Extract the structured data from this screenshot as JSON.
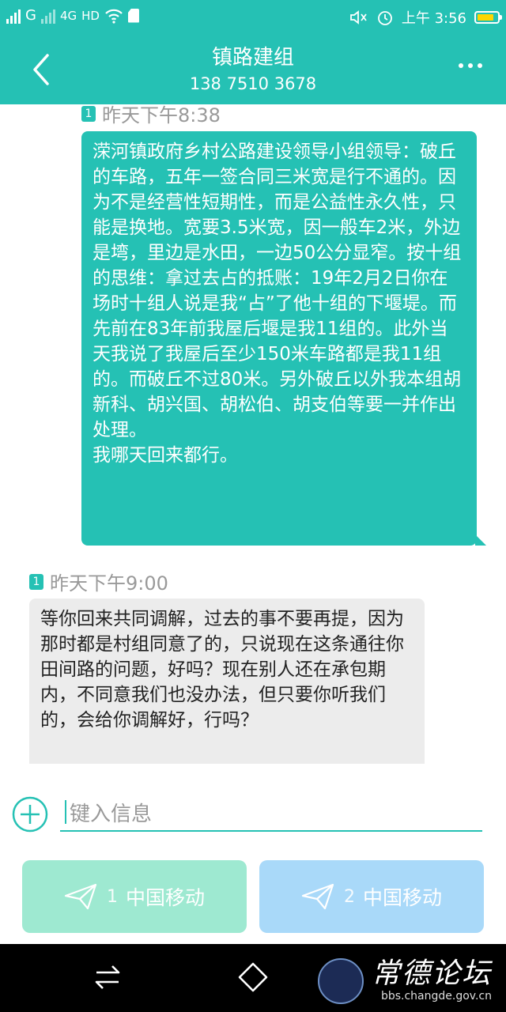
{
  "status_bar": {
    "sim1_label": "G",
    "network": "4G",
    "hd": "HD",
    "time": "上午 3:56",
    "icons": [
      "signal-icon",
      "signal-icon",
      "wifi-icon",
      "sim-card-icon",
      "mute-icon",
      "alarm-icon",
      "battery-icon"
    ],
    "battery_color": "#ffd600"
  },
  "header": {
    "title": "镇路建组",
    "phone": "138 7510 3678",
    "back_icon": "chevron-left-icon",
    "more_icon": "more-dots-icon",
    "bg_color": "#25c1b4"
  },
  "messages": [
    {
      "direction": "outgoing",
      "sim": "1",
      "time": "昨天下午8:38",
      "text": "溁河镇政府乡村公路建设领导小组领导：破丘的车路，五年一签合同三米宽是行不通的。因为不是经营性短期性，而是公益性永久性，只能是换地。宽要3.5米宽，因一般车2米，外边是塆，里边是水田，一边50公分显窄。按十组的思维：拿过去占的抵账：19年2月2日你在场时十组人说是我“占”了他十组的下堰堤。而先前在83年前我屋后堰是我11组的。此外当天我说了我屋后至少150米车路都是我11组的。而破丘不过80米。另外破丘以外我本组胡新科、胡兴国、胡松伯、胡支伯等要一并作出处理。\n我哪天回来都行。"
    },
    {
      "direction": "incoming",
      "sim": "1",
      "time": "昨天下午9:00",
      "text": "等你回来共同调解，过去的事不要再提，因为那时都是村组同意了的，只说现在这条通往你田间路的问题，好吗？现在别人还在承包期内，不同意我们也没办法，但只要你听我们的，会给你调解好，行吗？"
    }
  ],
  "composer": {
    "placeholder": "键入信息",
    "add_icon": "plus-circle-icon"
  },
  "send_buttons": [
    {
      "sim": "1",
      "label": "中国移动",
      "icon": "send-plane-icon",
      "color": "#9ee9d1"
    },
    {
      "sim": "2",
      "label": "中国移动",
      "icon": "send-plane-icon",
      "color": "#a9d9f9"
    }
  ],
  "nav_bar": {
    "icons": [
      "back-nav-icon",
      "home-nav-icon"
    ],
    "watermark_title": "常德论坛",
    "watermark_url": "bbs.changde.gov.cn"
  }
}
